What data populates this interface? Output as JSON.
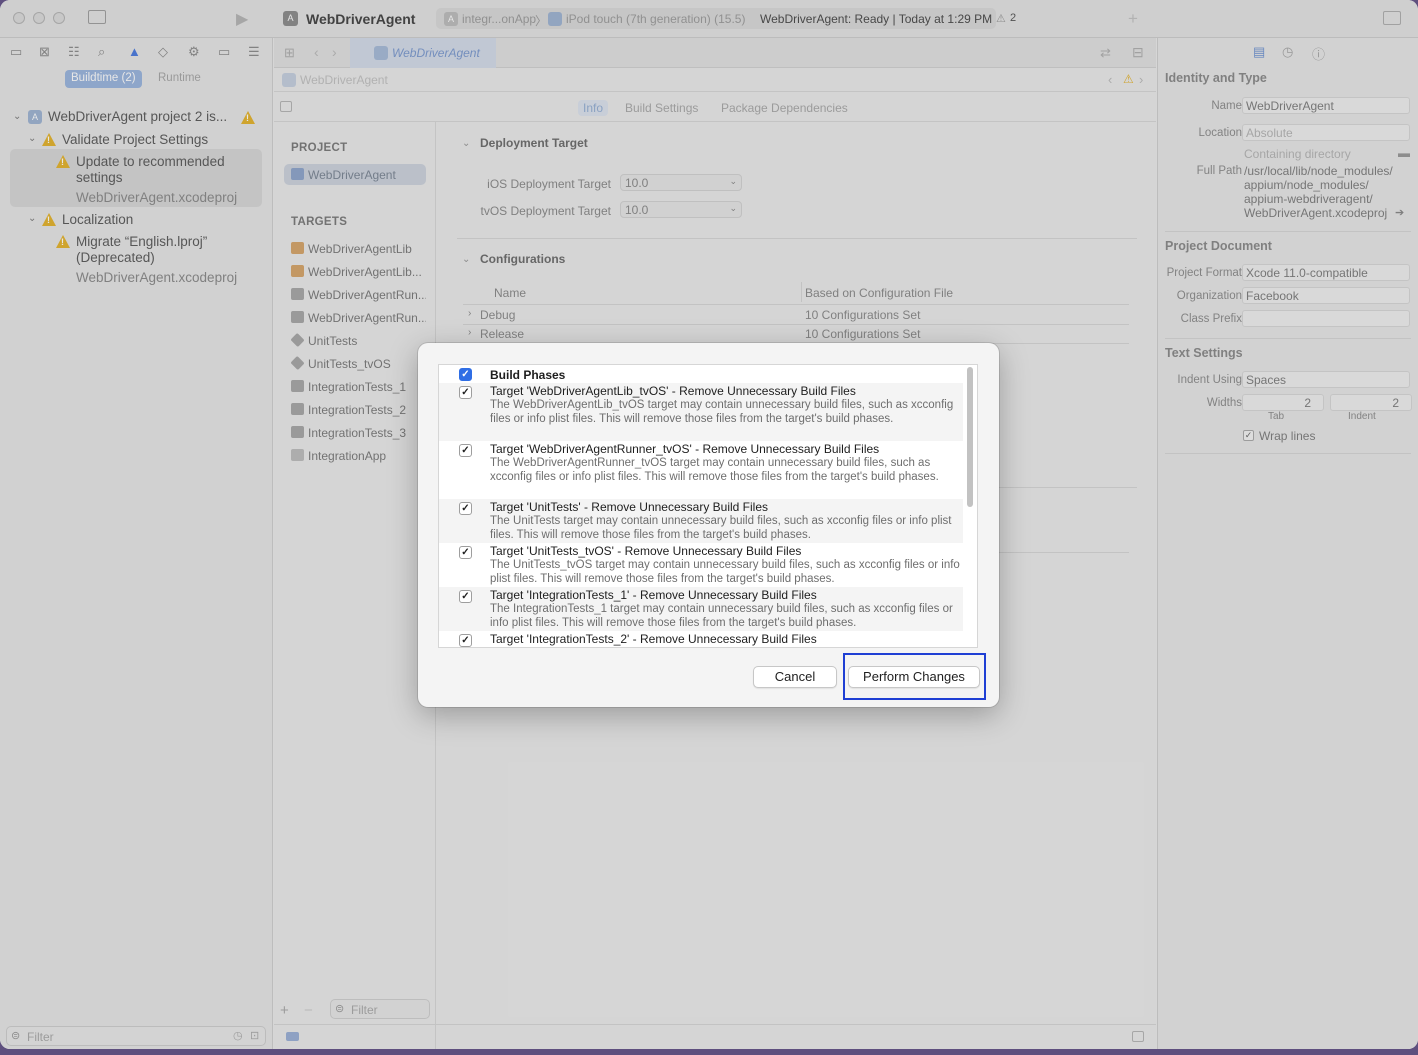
{
  "toolbar": {
    "app_title": "WebDriverAgent",
    "scheme": "integr...onApp",
    "separator": "〉",
    "device": "iPod touch (7th generation) (15.5)",
    "status": "WebDriverAgent: Ready | Today at 1:29 PM",
    "warning_count": "2"
  },
  "navigator": {
    "segments": [
      "Buildtime (2)",
      "Runtime"
    ],
    "issues": {
      "project": "WebDriverAgent project 2 is...",
      "group1": "Validate Project Settings",
      "issue1": "Update to recommended settings",
      "issue1_file": "WebDriverAgent.xcodeproj",
      "group2": "Localization",
      "issue2": "Migrate “English.lproj” (Deprecated)",
      "issue2_file": "WebDriverAgent.xcodeproj"
    },
    "filter_placeholder": "Filter"
  },
  "editor": {
    "tab_title": "WebDriverAgent",
    "jump": "WebDriverAgent",
    "tabs": [
      "Info",
      "Build Settings",
      "Package Dependencies"
    ],
    "project_header": "PROJECT",
    "project_item": "WebDriverAgent",
    "targets_header": "TARGETS",
    "targets": [
      "WebDriverAgentLib",
      "WebDriverAgentLib...",
      "WebDriverAgentRun...",
      "WebDriverAgentRun...",
      "UnitTests",
      "UnitTests_tvOS",
      "IntegrationTests_1",
      "IntegrationTests_2",
      "IntegrationTests_3",
      "IntegrationApp"
    ],
    "list_filter": "Filter",
    "deployment_title": "Deployment Target",
    "ios_label": "iOS Deployment Target",
    "ios_value": "10.0",
    "tvos_label": "tvOS Deployment Target",
    "tvos_value": "10.0",
    "configurations_title": "Configurations",
    "col_name": "Name",
    "col_based": "Based on Configuration File",
    "configs": [
      {
        "name": "Debug",
        "value": "10 Configurations Set"
      },
      {
        "name": "Release",
        "value": "10 Configurations Set"
      }
    ]
  },
  "inspector": {
    "identity_title": "Identity and Type",
    "name_label": "Name",
    "name_value": "WebDriverAgent",
    "location_label": "Location",
    "location_value": "Absolute",
    "containing": "Containing directory",
    "fullpath_label": "Full Path",
    "fullpath_lines": [
      "/usr/local/lib/node_modules/",
      "appium/node_modules/",
      "appium-webdriveragent/",
      "WebDriverAgent.xcodeproj"
    ],
    "project_doc_title": "Project Document",
    "format_label": "Project Format",
    "format_value": "Xcode 11.0-compatible",
    "org_label": "Organization",
    "org_value": "Facebook",
    "prefix_label": "Class Prefix",
    "prefix_value": "",
    "text_title": "Text Settings",
    "indent_label": "Indent Using",
    "indent_value": "Spaces",
    "widths_label": "Widths",
    "tab_width": "2",
    "indent_width": "2",
    "tab_caption": "Tab",
    "indent_caption": "Indent",
    "wrap_label": "Wrap lines"
  },
  "dialog": {
    "header": "Build Phases",
    "items": [
      {
        "title": "Target 'WebDriverAgentLib_tvOS' - Remove Unnecessary Build Files",
        "desc": "The WebDriverAgentLib_tvOS target may contain unnecessary build files, such as xcconfig files or info plist files.  This will remove those files from the target's build phases."
      },
      {
        "title": "Target 'WebDriverAgentRunner_tvOS' - Remove Unnecessary Build Files",
        "desc": "The WebDriverAgentRunner_tvOS target may contain unnecessary build files, such as xcconfig files or info plist files.  This will remove those files from the target's build phases."
      },
      {
        "title": "Target 'UnitTests' - Remove Unnecessary Build Files",
        "desc": "The UnitTests target may contain unnecessary build files, such as xcconfig files or info plist files.  This will remove those files from the target's build phases."
      },
      {
        "title": "Target 'UnitTests_tvOS' - Remove Unnecessary Build Files",
        "desc": "The UnitTests_tvOS target may contain unnecessary build files, such as xcconfig files or info plist files.  This will remove those files from the target's build phases."
      },
      {
        "title": "Target 'IntegrationTests_1' - Remove Unnecessary Build Files",
        "desc": "The IntegrationTests_1 target may contain unnecessary build files, such as xcconfig files or info plist files.  This will remove those files from the target's build phases."
      },
      {
        "title": "Target 'IntegrationTests_2' - Remove Unnecessary Build Files",
        "desc": ""
      }
    ],
    "cancel": "Cancel",
    "perform": "Perform Changes"
  }
}
